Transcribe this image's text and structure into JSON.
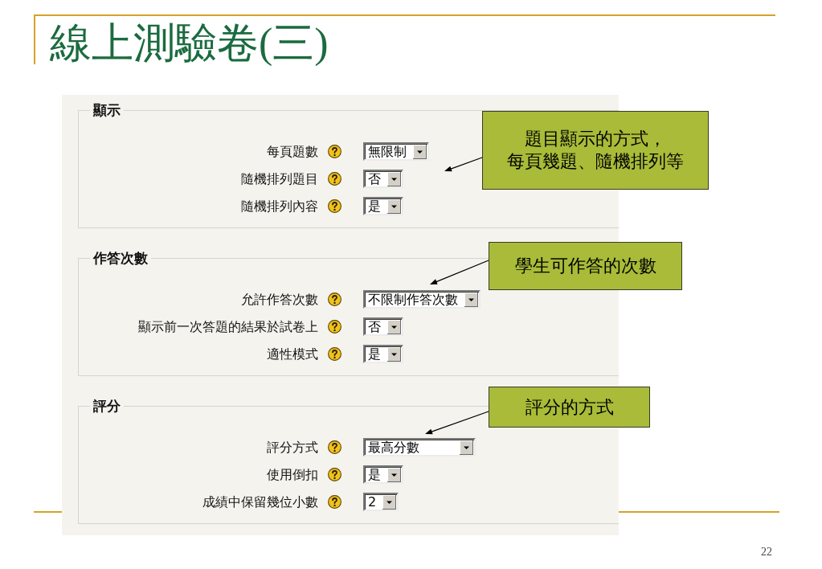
{
  "slide": {
    "title": "線上測驗卷(三)",
    "page_number": "22"
  },
  "form": {
    "sections": [
      {
        "legend": "顯示",
        "fields": [
          {
            "label": "每頁題數",
            "value": "無限制"
          },
          {
            "label": "隨機排列題目",
            "value": "否"
          },
          {
            "label": "隨機排列內容",
            "value": "是"
          }
        ]
      },
      {
        "legend": "作答次數",
        "fields": [
          {
            "label": "允許作答次數",
            "value": "不限制作答次數"
          },
          {
            "label": "顯示前一次答題的結果於試卷上",
            "value": "否"
          },
          {
            "label": "適性模式",
            "value": "是"
          }
        ]
      },
      {
        "legend": "評分",
        "fields": [
          {
            "label": "評分方式",
            "value": "最高分數"
          },
          {
            "label": "使用倒扣",
            "value": "是"
          },
          {
            "label": "成績中保留幾位小數",
            "value": "2"
          }
        ]
      }
    ]
  },
  "callouts": [
    {
      "lines": [
        "題目顯示的方式，",
        "每頁幾題、隨機排列等"
      ]
    },
    {
      "lines": [
        "學生可作答的次數"
      ]
    },
    {
      "lines": [
        "評分的方式"
      ]
    }
  ]
}
